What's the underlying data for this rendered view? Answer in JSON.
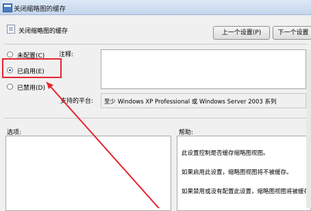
{
  "window": {
    "title": "关闭缩略图的缓存"
  },
  "policy": {
    "name": "关闭缩略图的缓存"
  },
  "nav": {
    "prev_label": "上一个设置(P)",
    "next_label": "下一个设置"
  },
  "radios": [
    {
      "label": "未配置(C)",
      "checked": false
    },
    {
      "label": "已启用(E)",
      "checked": true
    },
    {
      "label": "已禁用(D)",
      "checked": false
    }
  ],
  "comment": {
    "label": "注释:",
    "value": ""
  },
  "supported": {
    "label": "支持的平台:",
    "value": "至少 Windows XP Professional 或 Windows Server 2003 系列"
  },
  "options": {
    "label": "选项:"
  },
  "help": {
    "label": "帮助:",
    "lines": [
      "此设置控制是否缓存缩略图视图。",
      "如果启用此设置，缩略图视图将不被缓存。",
      "如果禁用或没有配置此设置，缩略图视图将被缓存。"
    ]
  },
  "colors": {
    "annotation": "#e8232c",
    "accent": "#1f5fb3"
  }
}
